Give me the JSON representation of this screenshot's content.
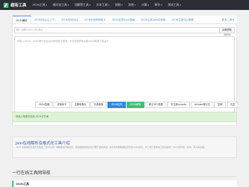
{
  "nav": {
    "logo": "超有工具",
    "items": [
      {
        "label": "JSON工具",
        "caret": "▾"
      },
      {
        "label": "格式化工具",
        "caret": "▾"
      },
      {
        "label": "加解密工具",
        "caret": "▾"
      },
      {
        "label": "文本工具",
        "caret": "▾"
      },
      {
        "label": "网络",
        "caret": "▾"
      },
      {
        "label": "其他",
        "caret": "▾"
      },
      {
        "label": "计算",
        "caret": "▾"
      },
      {
        "label": "章节",
        "caret": "▾"
      },
      {
        "label": "测试工具",
        "caret": "▾"
      }
    ]
  },
  "tabs": [
    {
      "label": "JSON解析",
      "active": true
    },
    {
      "label": "JSON对比(以上下)"
    },
    {
      "label": "JSON在线对比"
    },
    {
      "label": "JSON在线转换转义"
    },
    {
      "label": "JSON生成Excel表格"
    },
    {
      "label": "JSON生成Java实体类"
    },
    {
      "label": "JSON生成SQL数据"
    },
    {
      "label": "更多工具 ▾",
      "more": true
    }
  ],
  "url_input": {
    "placeholder": "输入远程JSON URL地址",
    "button": "远程获取JSON"
  },
  "editor": {
    "placeholder": "请输入JSON，JSON格式化会自动校验语法错误，点击按钮获取远程JSON数据下载运行"
  },
  "toolbar": [
    {
      "label": "JSON压缩",
      "style": "default"
    },
    {
      "label": "去除转义",
      "style": "default"
    },
    {
      "label": "注释转换为",
      "style": "default"
    },
    {
      "label": "中英转换",
      "style": "default"
    },
    {
      "label": "JSON化简",
      "style": "blue"
    },
    {
      "label": "JSON解析",
      "style": "green"
    },
    {
      "label": "单行GET参数",
      "style": "default"
    },
    {
      "label": "中文转Unicode",
      "style": "default"
    },
    {
      "label": "Unicode转中文",
      "style": "default"
    },
    {
      "label": "复制",
      "style": "default"
    },
    {
      "label": "清空",
      "style": "default"
    }
  ],
  "status": "请输入需要校验的JSON字符串",
  "intro": {
    "title": "json在线解析及格式化工具介绍",
    "text": "JSON 在线解析及格式化验证工具可以对一串数据进行格式化，使其更容易阅读也方便开发者调试，并自动判断数据是否符合JSON格式。为了便于使用本工具也提供了JSON序列化、化简、转义等功能。"
  },
  "nav_section": {
    "title": "一行在线工具网导航",
    "box_title": "JSON工具"
  }
}
